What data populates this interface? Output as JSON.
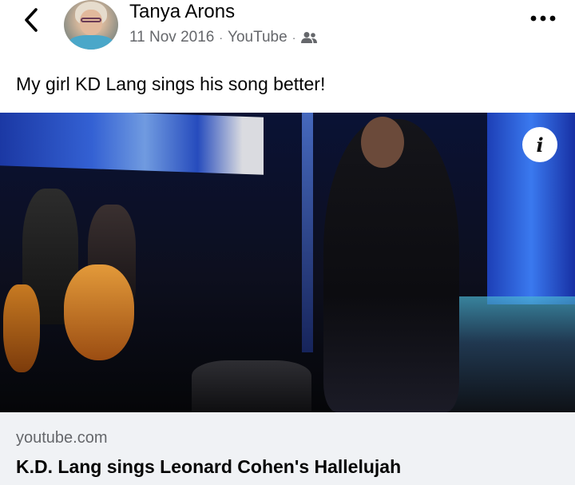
{
  "post": {
    "author": "Tanya Arons",
    "date": "11 Nov 2016",
    "separator": "·",
    "source": "YouTube",
    "audience_icon": "friends-icon",
    "text": "My girl KD Lang sings his song better!"
  },
  "icons": {
    "back": "chevron-left-icon",
    "more": "more-dots-icon",
    "info": "info-icon"
  },
  "video": {
    "info_label": "i"
  },
  "link": {
    "domain": "youtube.com",
    "title": "K.D. Lang sings Leonard Cohen's Hallelujah"
  },
  "colors": {
    "text_primary": "#050505",
    "text_secondary": "#65676b",
    "card_bg": "#f0f2f5"
  }
}
